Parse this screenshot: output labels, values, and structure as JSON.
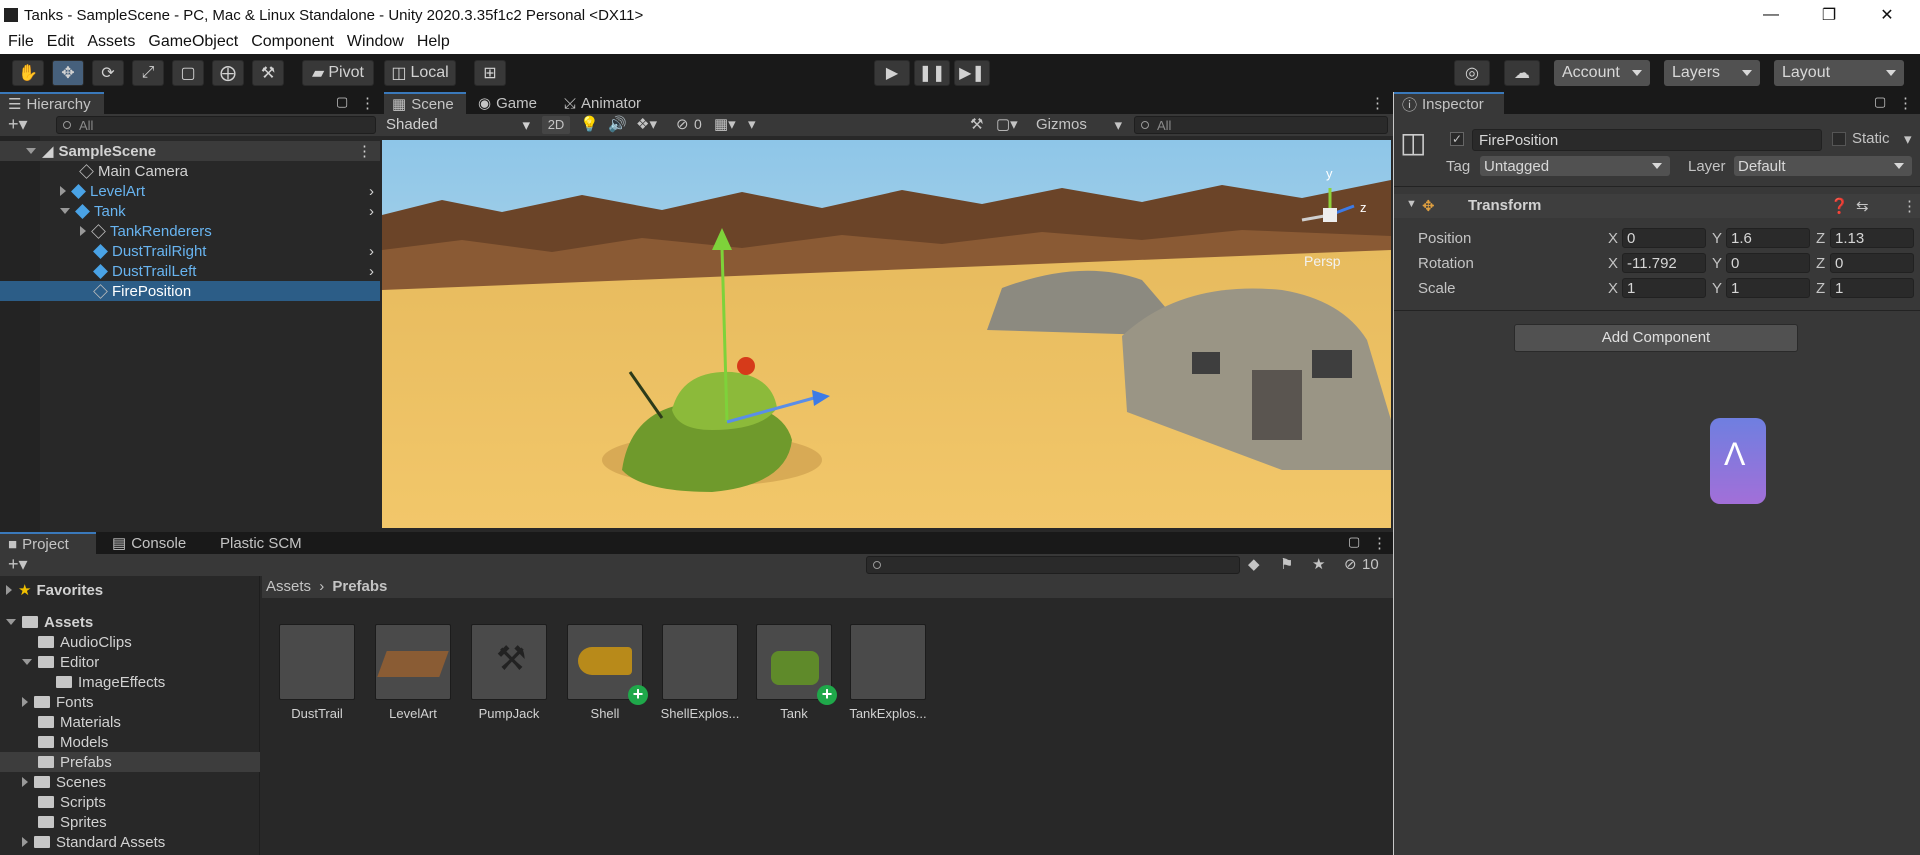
{
  "window": {
    "title": "Tanks - SampleScene - PC, Mac & Linux Standalone - Unity 2020.3.35f1c2 Personal <DX11>"
  },
  "menu": [
    "File",
    "Edit",
    "Assets",
    "GameObject",
    "Component",
    "Window",
    "Help"
  ],
  "toolbar": {
    "pivot": "Pivot",
    "local": "Local",
    "account": "Account",
    "layers": "Layers",
    "layout": "Layout"
  },
  "hierarchy": {
    "tab": "Hierarchy",
    "search_placeholder": "All",
    "items": [
      {
        "label": "SampleScene",
        "depth": 0,
        "expanded": true,
        "kind": "scene"
      },
      {
        "label": "Main Camera",
        "depth": 1,
        "kind": "object"
      },
      {
        "label": "LevelArt",
        "depth": 1,
        "kind": "prefab",
        "collapsed": true
      },
      {
        "label": "Tank",
        "depth": 1,
        "kind": "prefab",
        "expanded": true
      },
      {
        "label": "TankRenderers",
        "depth": 2,
        "kind": "object",
        "collapsed": true
      },
      {
        "label": "DustTrailRight",
        "depth": 2,
        "kind": "prefab"
      },
      {
        "label": "DustTrailLeft",
        "depth": 2,
        "kind": "prefab"
      },
      {
        "label": "FirePosition",
        "depth": 2,
        "kind": "object",
        "selected": true
      }
    ]
  },
  "scene": {
    "tabs": [
      "Scene",
      "Game",
      "Animator"
    ],
    "shading": "Shaded",
    "mode2d": "2D",
    "hidden_count": "0",
    "gizmos": "Gizmos",
    "search_placeholder": "All",
    "persp": "Persp",
    "axis_y": "y",
    "axis_z": "z"
  },
  "inspector": {
    "tab": "Inspector",
    "object_name": "FirePosition",
    "static_label": "Static",
    "tag_label": "Tag",
    "tag_value": "Untagged",
    "layer_label": "Layer",
    "layer_value": "Default",
    "component": "Transform",
    "rows": [
      {
        "label": "Position",
        "x": "0",
        "y": "1.6",
        "z": "1.13"
      },
      {
        "label": "Rotation",
        "x": "-11.792",
        "y": "0",
        "z": "0"
      },
      {
        "label": "Scale",
        "x": "1",
        "y": "1",
        "z": "1"
      }
    ],
    "add_component": "Add Component"
  },
  "project": {
    "tabs": [
      "Project",
      "Console",
      "Plastic SCM"
    ],
    "hidden_count": "10",
    "favorites": "Favorites",
    "tree": [
      {
        "label": "Assets",
        "depth": 0,
        "expanded": true
      },
      {
        "label": "AudioClips",
        "depth": 1
      },
      {
        "label": "Editor",
        "depth": 1,
        "expanded": true
      },
      {
        "label": "ImageEffects",
        "depth": 2
      },
      {
        "label": "Fonts",
        "depth": 1,
        "collapsed": true
      },
      {
        "label": "Materials",
        "depth": 1
      },
      {
        "label": "Models",
        "depth": 1
      },
      {
        "label": "Prefabs",
        "depth": 1,
        "selected": true
      },
      {
        "label": "Scenes",
        "depth": 1,
        "collapsed": true
      },
      {
        "label": "Scripts",
        "depth": 1
      },
      {
        "label": "Sprites",
        "depth": 1
      },
      {
        "label": "Standard Assets",
        "depth": 1,
        "collapsed": true
      }
    ],
    "breadcrumb": [
      "Assets",
      "Prefabs"
    ],
    "assets": [
      {
        "label": "DustTrail"
      },
      {
        "label": "LevelArt"
      },
      {
        "label": "PumpJack"
      },
      {
        "label": "Shell",
        "plus": true
      },
      {
        "label": "ShellExplos..."
      },
      {
        "label": "Tank",
        "plus": true
      },
      {
        "label": "TankExplos..."
      }
    ]
  },
  "colors": {
    "accent": "#3a79bb",
    "selection": "#2c5d87",
    "prefab_blue": "#68b4f0"
  }
}
